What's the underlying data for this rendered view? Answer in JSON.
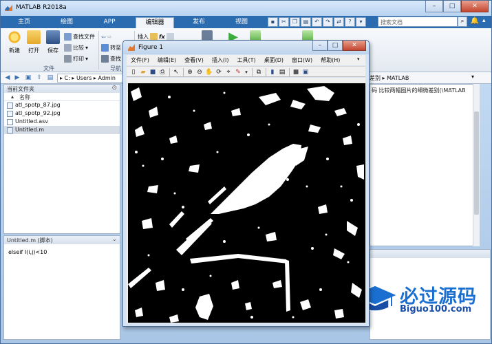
{
  "matlab": {
    "title": "MATLAB R2018a",
    "ribbon_tabs": [
      "主页",
      "绘图",
      "APP",
      "编辑器",
      "发布",
      "视图"
    ],
    "active_tab": "编辑器",
    "search_placeholder": "搜索文档",
    "ribbon": {
      "new_label": "新建",
      "open_label": "打开",
      "save_label": "保存",
      "find_files_label": "查找文件",
      "compare_label": "比较",
      "print_label": "打印",
      "goto_label": "转至",
      "find_label": "查找",
      "insert_label": "插入",
      "file_group": "文件",
      "navigate_group": "导航"
    },
    "address": {
      "path_parts": [
        "C:",
        "Users",
        "Admin"
      ],
      "right_path": "差别 ▸ MATLAB"
    },
    "current_folder": {
      "header": "当前文件夹",
      "name_col": "名称",
      "files": [
        {
          "name": "atl_spotp_87.jpg",
          "selected": false
        },
        {
          "name": "atl_spotp_92.jpg",
          "selected": false
        },
        {
          "name": "Untitled.asv",
          "selected": false
        },
        {
          "name": "Untitled.m",
          "selected": true
        }
      ]
    },
    "editor_panel": {
      "header": "Untitled.m  (脚本)",
      "code_line": "elseif I(i,j)<10"
    },
    "right_panel": {
      "header": "码 比较两幅图片的细微差别(\\MATLAB"
    },
    "watermark": {
      "cn": "必过源码",
      "en": "Biguo100.com"
    }
  },
  "figure": {
    "title": "Figure 1",
    "menus": [
      "文件(F)",
      "编辑(E)",
      "查看(V)",
      "插入(I)",
      "工具(T)",
      "桌面(D)",
      "窗口(W)",
      "帮助(H)"
    ]
  },
  "colors": {
    "ribbon_blue": "#2b6cb0",
    "figure_frame": "#d7e4f3",
    "image_bg": "#000000"
  }
}
